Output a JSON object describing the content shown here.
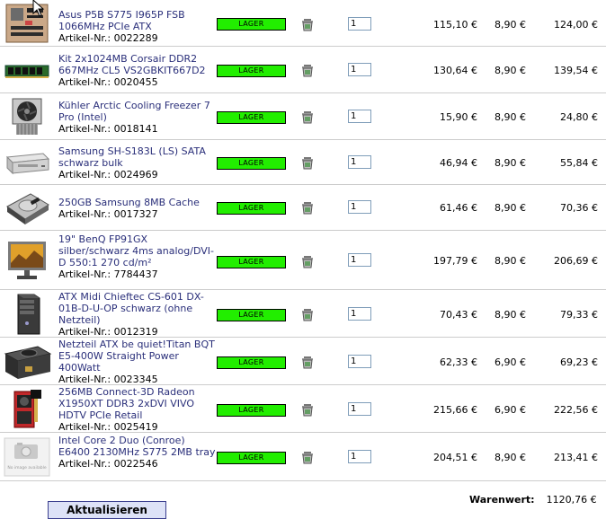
{
  "cart": {
    "stock_label": "LAGER",
    "items": [
      {
        "name": "Asus P5B S775 I965P FSB 1066MHz PCIe ATX",
        "article": "Artikel-Nr.: 0022289",
        "qty": "1",
        "price": "115,10 €",
        "shipping": "8,90 €",
        "total": "124,00 €",
        "icon": "motherboard-icon"
      },
      {
        "name": "Kit 2x1024MB Corsair DDR2 667MHz CL5 VS2GBKIT667D2",
        "article": "Artikel-Nr.: 0020455",
        "qty": "1",
        "price": "130,64 €",
        "shipping": "8,90 €",
        "total": "139,54 €",
        "icon": "ram-icon"
      },
      {
        "name": "Kühler Arctic Cooling Freezer 7 Pro (Intel)",
        "article": "Artikel-Nr.: 0018141",
        "qty": "1",
        "price": "15,90 €",
        "shipping": "8,90 €",
        "total": "24,80 €",
        "icon": "cpu-cooler-icon"
      },
      {
        "name": "Samsung SH-S183L (LS) SATA schwarz bulk",
        "article": "Artikel-Nr.: 0024969",
        "qty": "1",
        "price": "46,94 €",
        "shipping": "8,90 €",
        "total": "55,84 €",
        "icon": "dvd-drive-icon"
      },
      {
        "name": "250GB Samsung 8MB Cache",
        "article": "Artikel-Nr.: 0017327",
        "qty": "1",
        "price": "61,46 €",
        "shipping": "8,90 €",
        "total": "70,36 €",
        "icon": "hard-drive-icon"
      },
      {
        "name": "19\" BenQ FP91GX silber/schwarz 4ms analog/DVI-D 550:1 270 cd/m²",
        "article": "Artikel-Nr.: 7784437",
        "qty": "1",
        "price": "197,79 €",
        "shipping": "8,90 €",
        "total": "206,69 €",
        "icon": "monitor-icon"
      },
      {
        "name": "ATX Midi Chieftec CS-601 DX-01B-D-U-OP schwarz (ohne Netzteil)",
        "article": "Artikel-Nr.: 0012319",
        "qty": "1",
        "price": "70,43 €",
        "shipping": "8,90 €",
        "total": "79,33 €",
        "icon": "pc-case-icon"
      },
      {
        "name": "Netzteil ATX be quiet!Titan BQT E5-400W Straight Power 400Watt",
        "article": "Artikel-Nr.: 0023345",
        "qty": "1",
        "price": "62,33 €",
        "shipping": "6,90 €",
        "total": "69,23 €",
        "icon": "power-supply-icon"
      },
      {
        "name": "256MB Connect-3D Radeon X1950XT DDR3 2xDVI VIVO HDTV PCIe Retail",
        "article": "Artikel-Nr.: 0025419",
        "qty": "1",
        "price": "215,66 €",
        "shipping": "6,90 €",
        "total": "222,56 €",
        "icon": "graphics-card-icon"
      },
      {
        "name": "Intel Core 2 Duo (Conroe) E6400 2130MHz S775 2MB tray",
        "article": "Artikel-Nr.: 0022546",
        "qty": "1",
        "price": "204,51 €",
        "shipping": "8,90 €",
        "total": "213,41 €",
        "icon": "no-image-icon"
      }
    ],
    "no_image_text": "No image available",
    "total_label": "Warenwert:",
    "total_value": "1120,76 €",
    "update_label": "Aktualisieren"
  }
}
